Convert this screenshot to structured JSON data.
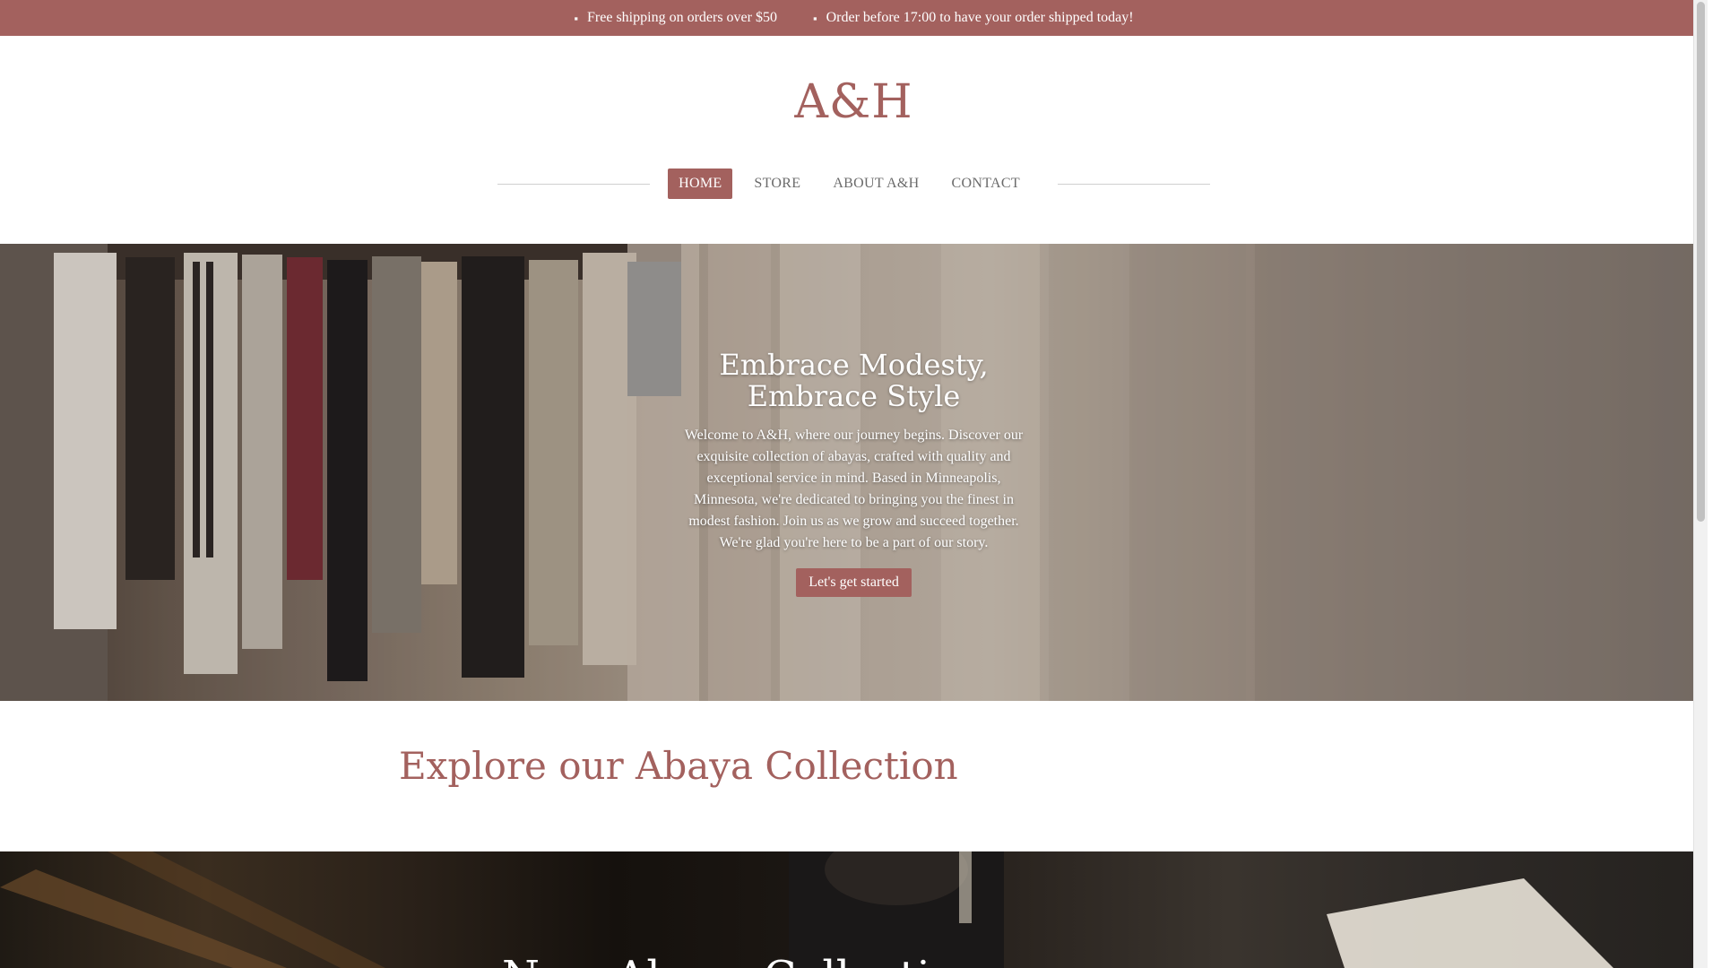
{
  "announcement": {
    "shipping_icon": "truck-icon",
    "shipping_text": "Free shipping on orders over $50",
    "clock_icon": "clock-icon",
    "order_text": "Order before 17:00 to have your order shipped today!"
  },
  "header": {
    "logo": "A&H",
    "nav": [
      {
        "label": "HOME",
        "active": true
      },
      {
        "label": "STORE",
        "active": false
      },
      {
        "label": "ABOUT A&H",
        "active": false
      },
      {
        "label": "CONTACT",
        "active": false
      }
    ]
  },
  "hero": {
    "title": "Embrace Modesty, Embrace Style",
    "text": "Welcome to A&H, where our journey begins. Discover our exquisite collection of abayas, crafted with quality and exceptional service in mind. Based in Minneapolis, Minnesota, we're dedicated to bringing you the finest in modest fashion. Join us as we grow and succeed together. We're glad you're here to be a part of our story.",
    "button_label": "Let's get started"
  },
  "collection": {
    "heading": "Explore our Abaya Collection"
  },
  "banner": {
    "title": "New Abaya Collection"
  },
  "colors": {
    "accent": "#a3615e",
    "nav_text": "#6b6b6b"
  }
}
